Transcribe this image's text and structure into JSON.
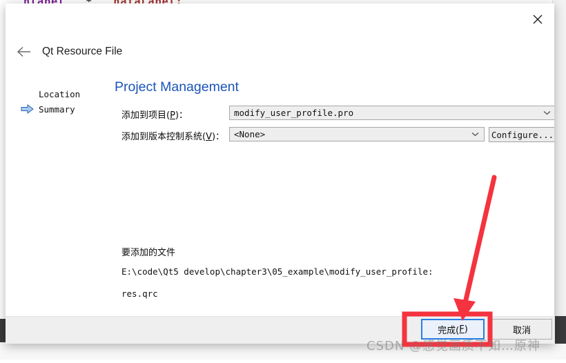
{
  "background": {
    "code_fragment_a": "nlabel",
    "code_fragment_b": "*",
    "code_fragment_c": "nataLabel;"
  },
  "dialog": {
    "close_icon": "close-icon",
    "back_icon": "back-arrow-icon",
    "title": "Qt Resource File",
    "heading": "Project Management",
    "sidebar": {
      "items": [
        {
          "label": "Location",
          "selected": false
        },
        {
          "label": "Summary",
          "selected": true
        }
      ],
      "current_marker_icon": "blue-right-arrow-icon"
    },
    "form": {
      "rows": [
        {
          "label_prefix": "添加到项目(",
          "label_accel": "P",
          "label_suffix": ")：",
          "value": "modify_user_profile.pro",
          "chevron_icon": "chevron-down-icon"
        },
        {
          "label_prefix": "添加到版本控制系统(",
          "label_accel": "V",
          "label_suffix": ")：",
          "value": "<None>",
          "chevron_icon": "chevron-down-icon"
        }
      ],
      "configure_button": "Configure..."
    },
    "files": {
      "title": "要添加的文件",
      "path": "E:\\code\\Qt5 develop\\chapter3\\05_example\\modify_user_profile:",
      "entry": "res.qrc"
    },
    "footer": {
      "finish_prefix": "完成(",
      "finish_accel": "F",
      "finish_suffix": ")",
      "cancel": "取消"
    }
  },
  "annotations": {
    "highlight_color": "#f5333f",
    "arrow_name": "red-pointer-arrow",
    "rect_name": "red-highlight-rectangle"
  },
  "watermark": {
    "text": "CSDN @感觉画质不如…原神"
  },
  "colors": {
    "heading_blue": "#1a54b8",
    "default_button_border": "#2a7de1",
    "annotation_red": "#f5333f",
    "dialog_footer": "#efefef"
  }
}
